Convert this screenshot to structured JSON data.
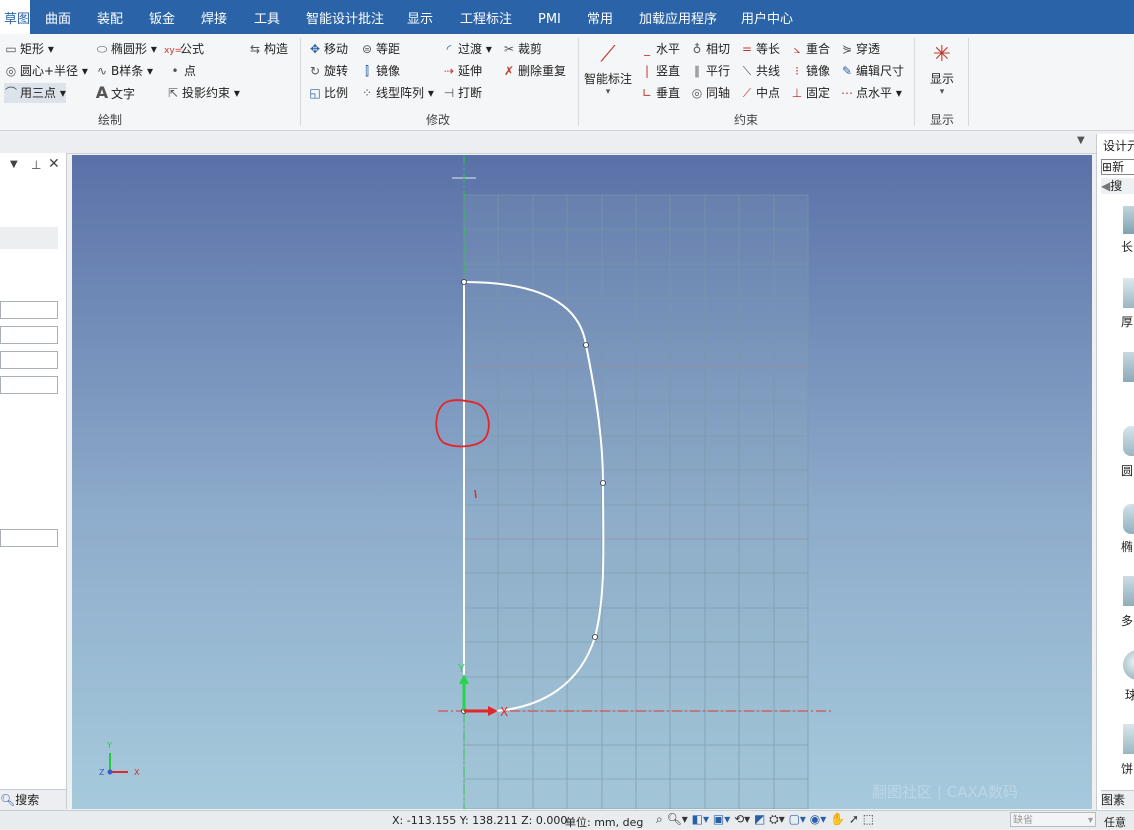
{
  "menu": [
    "草图",
    "曲面",
    "装配",
    "钣金",
    "焊接",
    "工具",
    "智能设计批注",
    "显示",
    "工程标注",
    "PMI",
    "常用",
    "加载应用程序",
    "用户中心"
  ],
  "ribbon": {
    "draw": {
      "label": "绘制",
      "rect": "矩形",
      "circle": "圆心+半径",
      "threepoint": "用三点",
      "ellipse": "椭圆形",
      "bspline": "B样条",
      "text": "文字",
      "formula": "公式",
      "point": "点",
      "projection": "投影约束",
      "construct": "构造"
    },
    "modify": {
      "label": "修改",
      "move": "移动",
      "rotate": "旋转",
      "scale": "比例",
      "offset": "等距",
      "mirror": "镜像",
      "linear_array": "线型阵列",
      "transition": "过渡",
      "extend": "延伸",
      "break": "打断",
      "trim": "裁剪",
      "delete_dup": "删除重复"
    },
    "constraint": {
      "label": "约束",
      "smart_dim": "智能标注",
      "horizontal": "水平",
      "vertical": "竖直",
      "perpendicular": "垂直",
      "tangent": "相切",
      "parallel": "平行",
      "coaxial": "同轴",
      "equal": "等长",
      "collinear": "共线",
      "midpoint": "中点",
      "coincident": "重合",
      "mirror": "镜像",
      "fixed": "固定",
      "pierce": "穿透",
      "edit_dim": "编辑尺寸",
      "point_horizontal": "点水平"
    },
    "display": {
      "label": "显示",
      "button": "显示"
    }
  },
  "left_panel": {
    "search": "搜索"
  },
  "right_panel": {
    "title": "设计元",
    "new": "新",
    "search": "搜",
    "items": [
      "长",
      "厚",
      "",
      "圆",
      "椭",
      "多",
      "球",
      "饼"
    ],
    "bottom_tab": "图素"
  },
  "viewport": {
    "axis_x": "X",
    "axis_y": "Y",
    "triad_x": "X",
    "triad_y": "Y",
    "triad_z": "Z",
    "watermark": "翻图社区 | CAXA数码"
  },
  "status": {
    "coords": "X: -113.155 Y: 138.211 Z: 0.000",
    "units": "单位: mm, deg",
    "default_field": "缺省",
    "any": "任意"
  }
}
